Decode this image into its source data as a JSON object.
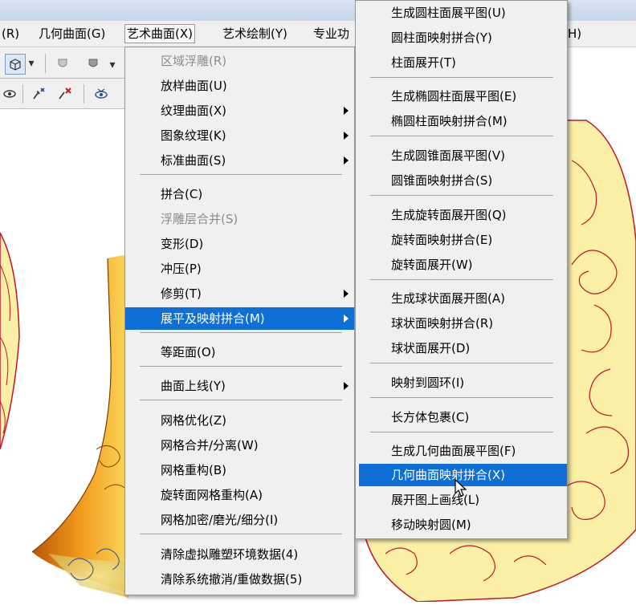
{
  "menubar": {
    "items": [
      {
        "label": "(R)"
      },
      {
        "label": "几何曲面(G)"
      },
      {
        "label": "艺术曲面(X)"
      },
      {
        "label": "艺术绘制(Y)"
      },
      {
        "label": "专业功"
      },
      {
        "label": "H)"
      }
    ]
  },
  "main_menu": {
    "items": [
      {
        "label": "区域浮雕(R)"
      },
      {
        "label": "放样曲面(U)"
      },
      {
        "label": "纹理曲面(X)"
      },
      {
        "label": "图象纹理(K)"
      },
      {
        "label": "标准曲面(S)"
      },
      {
        "label": "拼合(C)"
      },
      {
        "label": "浮雕层合并(S)"
      },
      {
        "label": "变形(D)"
      },
      {
        "label": "冲压(P)"
      },
      {
        "label": "修剪(T)"
      },
      {
        "label": "展平及映射拼合(M)"
      },
      {
        "label": "等距面(O)"
      },
      {
        "label": "曲面上线(Y)"
      },
      {
        "label": "网格优化(Z)"
      },
      {
        "label": "网格合并/分离(W)"
      },
      {
        "label": "网格重构(B)"
      },
      {
        "label": "旋转面网格重构(A)"
      },
      {
        "label": "网格加密/磨光/细分(I)"
      },
      {
        "label": "清除虚拟雕塑环境数据(4)"
      },
      {
        "label": "清除系统撤消/重做数据(5)"
      }
    ]
  },
  "submenu": {
    "items": [
      {
        "label": "生成圆柱面展平图(U)"
      },
      {
        "label": "圆柱面映射拼合(Y)"
      },
      {
        "label": "柱面展开(T)"
      },
      {
        "label": "生成椭圆柱面展平图(E)"
      },
      {
        "label": "椭圆柱面映射拼合(M)"
      },
      {
        "label": "生成圆锥面展平图(V)"
      },
      {
        "label": "圆锥面映射拼合(S)"
      },
      {
        "label": "生成旋转面展开图(Q)"
      },
      {
        "label": "旋转面映射拼合(E)"
      },
      {
        "label": "旋转面展开(W)"
      },
      {
        "label": "生成球状面展开图(A)"
      },
      {
        "label": "球状面映射拼合(R)"
      },
      {
        "label": "球状面展开(D)"
      },
      {
        "label": "映射到圆环(I)"
      },
      {
        "label": "长方体包裹(C)"
      },
      {
        "label": "生成几何曲面展平图(F)"
      },
      {
        "label": "几何曲面映射拼合(X)"
      },
      {
        "label": "展开图上画线(L)"
      },
      {
        "label": "移动映射圆(M)"
      }
    ]
  },
  "colors": {
    "highlight": "#0e6fd6",
    "pattern_fill": "#fbf0a6",
    "pattern_line": "#c0162a",
    "relief_orange": "#e88a10"
  }
}
